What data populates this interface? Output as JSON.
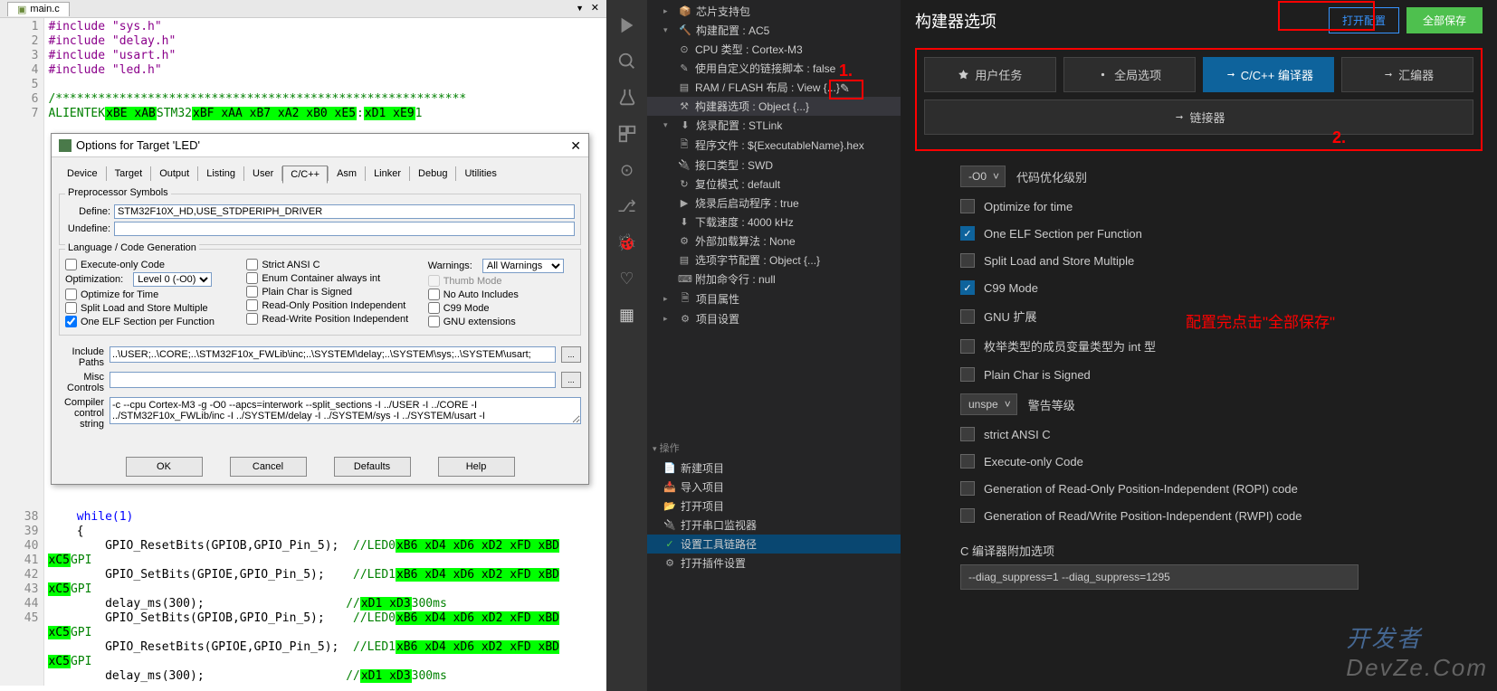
{
  "leftTab": {
    "filename": "main.c"
  },
  "code": {
    "l1": "#include \"sys.h\"",
    "l2": "#include \"delay.h\"",
    "l3": "#include \"usart.h\"",
    "l4": "#include \"led.h\"",
    "l7a": " ALIENTEK",
    "l7b": "STM32",
    "l40a": "GPIO_ResetBits(GPIOB,GPIO_Pin_5);",
    "l40b": "//LED0",
    "l41a": "GPIO_SetBits(GPIOE,GPIO_Pin_5);",
    "l41b": "//LED1",
    "l42a": "delay_ms(300);",
    "l42b": "//",
    "l42c": "300ms",
    "l43a": "GPIO_SetBits(GPIOB,GPIO_Pin_5);",
    "l43b": "//LED0",
    "l44a": "GPIO_ResetBits(GPIOE,GPIO_Pin_5);",
    "l44b": "//LED1",
    "l45a": "delay_ms(300);",
    "l45b": "//",
    "l45c": "300ms",
    "while": "while(1)",
    "brace": "{",
    "hlBytes": "xB6 xD4 xD6 xD2 xFD xBD xC5",
    "hlBytes2": "xBE xAB",
    "hlBytes3": "xBF xAA xB7 xA2 xB0 xE5",
    "hlBytes4": "xD1 xD3",
    "hlBytes5": "xD1 xE9",
    "lineNums": [
      "1",
      "2",
      "3",
      "4",
      "5",
      "6",
      "7",
      "",
      "",
      "",
      "",
      "",
      "",
      "",
      "",
      "",
      "",
      "",
      "",
      "",
      "",
      "",
      "",
      "",
      "",
      "",
      "",
      "",
      "",
      "",
      "",
      "",
      "",
      "",
      "",
      "",
      "38",
      "39",
      "40",
      "41",
      "42",
      "43",
      "44",
      "45"
    ]
  },
  "dialog": {
    "title": "Options for Target 'LED'",
    "tabs": [
      "Device",
      "Target",
      "Output",
      "Listing",
      "User",
      "C/C++",
      "Asm",
      "Linker",
      "Debug",
      "Utilities"
    ],
    "group1": "Preprocessor Symbols",
    "defineLabel": "Define:",
    "defineVal": "STM32F10X_HD,USE_STDPERIPH_DRIVER",
    "undefineLabel": "Undefine:",
    "group2": "Language / Code Generation",
    "execOnly": "Execute-only Code",
    "optLabel": "Optimization:",
    "optVal": "Level 0 (-O0)",
    "optTime": "Optimize for Time",
    "splitLoad": "Split Load and Store Multiple",
    "oneELF": "One ELF Section per Function",
    "strictAnsi": "Strict ANSI C",
    "enumCont": "Enum Container always int",
    "plainChar": "Plain Char is Signed",
    "roPos": "Read-Only Position Independent",
    "rwPos": "Read-Write Position Independent",
    "warnLabel": "Warnings:",
    "warnVal": "All Warnings",
    "thumbMode": "Thumb Mode",
    "noAuto": "No Auto Includes",
    "c99": "C99 Mode",
    "gnuExt": "GNU extensions",
    "inclLabel": "Include\nPaths",
    "inclVal": "..\\USER;..\\CORE;..\\STM32F10x_FWLib\\inc;..\\SYSTEM\\delay;..\\SYSTEM\\sys;..\\SYSTEM\\usart;",
    "miscLabel": "Misc\nControls",
    "compLabel": "Compiler\ncontrol\nstring",
    "compVal": "-c --cpu Cortex-M3 -g -O0 --apcs=interwork --split_sections -I ../USER -I ../CORE -I ../STM32F10x_FWLib/inc -I ../SYSTEM/delay -I ../SYSTEM/sys -I ../SYSTEM/usart -I",
    "btnOK": "OK",
    "btnCancel": "Cancel",
    "btnDefaults": "Defaults",
    "btnHelp": "Help"
  },
  "tree": {
    "chipSupport": "芯片支持包",
    "buildConfig": "构建配置 : AC5",
    "cpuType": "CPU 类型 : Cortex-M3",
    "customScript": "使用自定义的链接脚本 : false",
    "ramFlash": "RAM / FLASH 布局 : View {...}",
    "builderOpt": "构建器选项 : Object {...}",
    "flashConfig": "烧录配置 : STLink",
    "progFile": "程序文件 : ${ExecutableName}.hex",
    "ifType": "接口类型 : SWD",
    "resetMode": "复位模式 : default",
    "launchApp": "烧录后启动程序 : true",
    "dlSpeed": "下载速度 : 4000 kHz",
    "extAlgo": "外部加载算法 : None",
    "optSection": "选项字节配置 : Object {...}",
    "extraCmd": "附加命令行 : null",
    "projAttr": "项目属性",
    "projSettings": "项目设置",
    "opsHeader": "操作",
    "newProj": "新建项目",
    "importProj": "导入项目",
    "openProj": "打开项目",
    "openSerial": "打开串口监视器",
    "setToolchain": "设置工具链路径",
    "openPlugin": "打开插件设置"
  },
  "main": {
    "title": "构建器选项",
    "openConfig": "打开配置",
    "saveAll": "全部保存",
    "tabs": {
      "user": "用户任务",
      "global": "全局选项",
      "cc": "C/C++ 编译器",
      "asm": "汇编器",
      "linker": "链接器"
    },
    "optSelect": "-O0",
    "optLevelLabel": "代码优化级别",
    "optTime": "Optimize for time",
    "oneELF": "One ELF Section per Function",
    "splitLoad": "Split Load and Store Multiple",
    "c99": "C99 Mode",
    "gnuExt": "GNU 扩展",
    "enumInt": "枚举类型的成员变量类型为 int 型",
    "plainChar": "Plain Char is Signed",
    "warnSelect": "unspe",
    "warnLabel": "警告等级",
    "strictAnsi": "strict ANSI C",
    "execOnly": "Execute-only Code",
    "ropi": "Generation of Read-Only Position-Independent (ROPI) code",
    "rwpi": "Generation of Read/Write Position-Independent (RWPI) code",
    "extraLabel": "C 编译器附加选项",
    "extraVal": "--diag_suppress=1 --diag_suppress=1295"
  },
  "annotations": {
    "a1": "1.",
    "a2": "2.",
    "a3": "配置完点击\"全部保存\""
  },
  "watermark1": "开发者",
  "watermark2": "DevZe.Com"
}
